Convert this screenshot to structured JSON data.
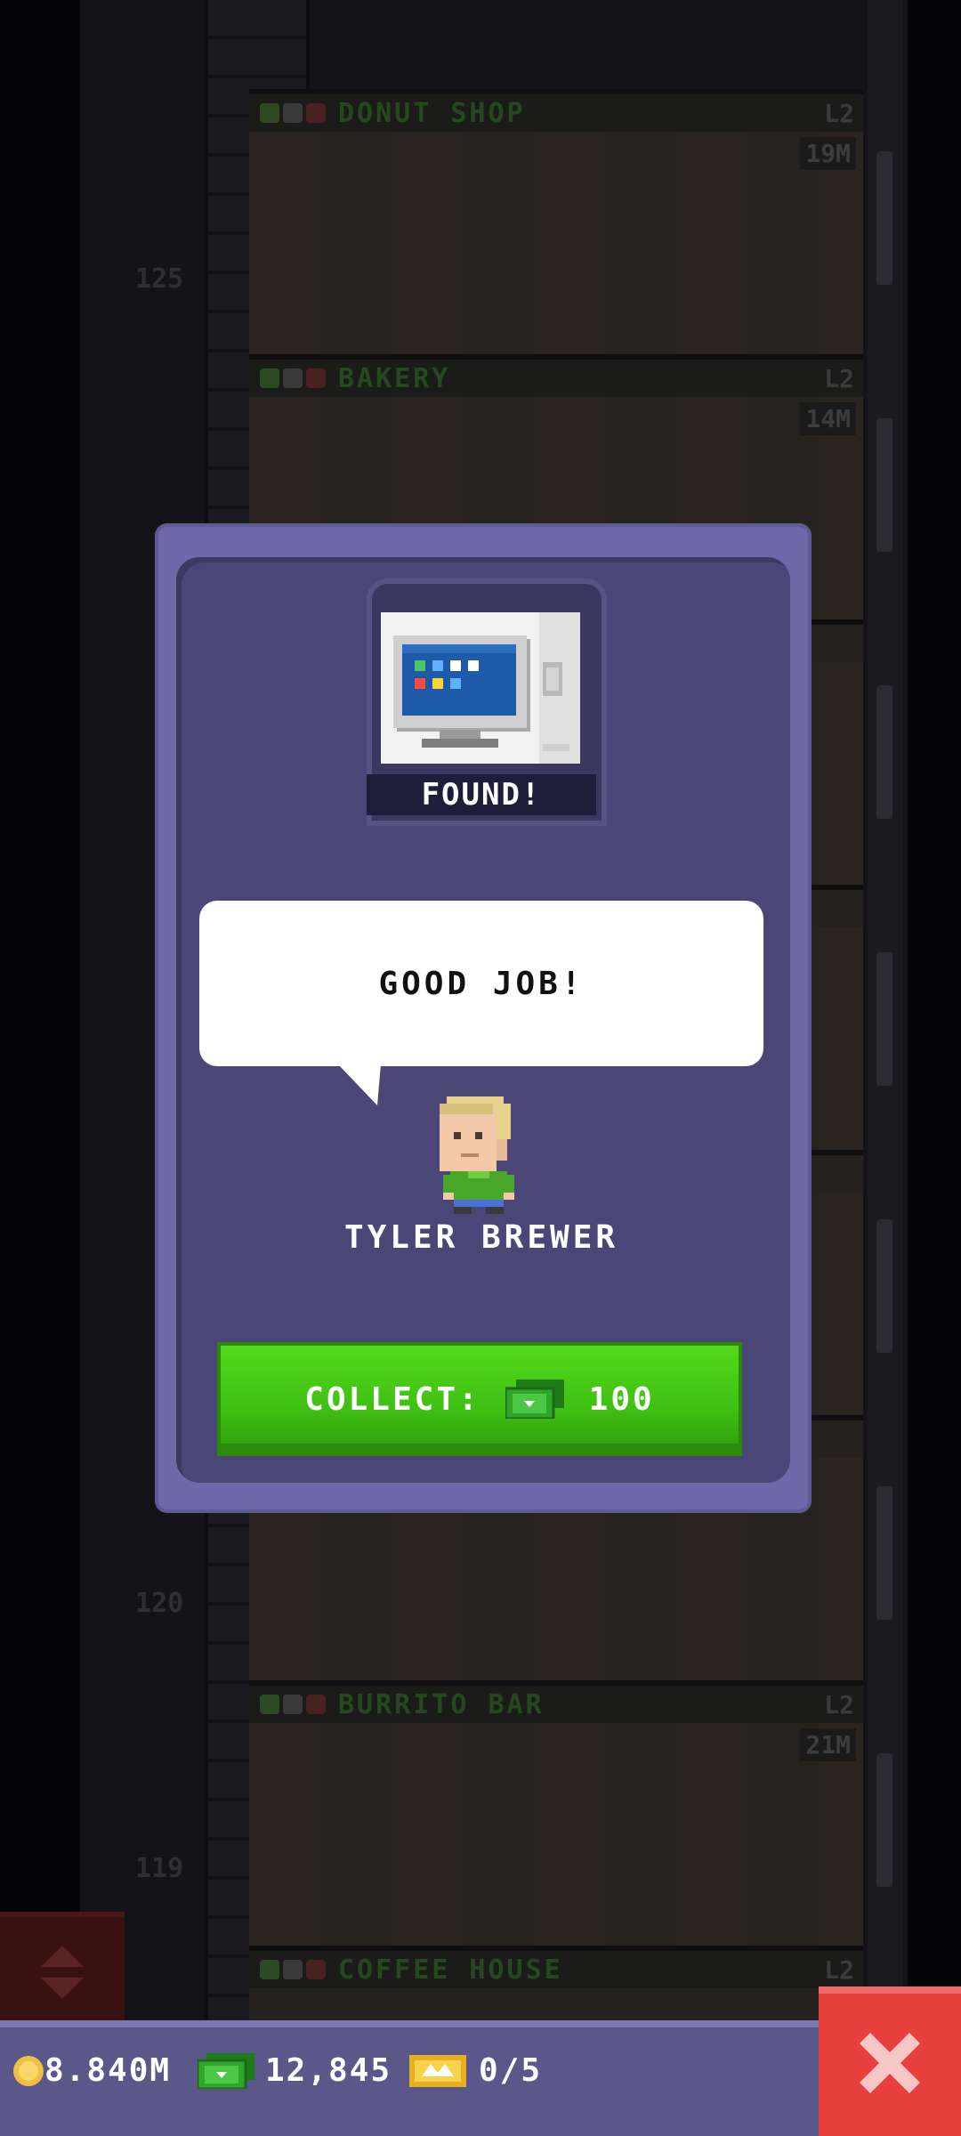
{
  "tower": {
    "floors": [
      {
        "name": "DONUT SHOP",
        "level": "L2",
        "income": "19M",
        "number": "125"
      },
      {
        "name": "BAKERY",
        "level": "L2",
        "income": "14M",
        "number": ""
      },
      {
        "name": "BURRITO BAR",
        "level": "L2",
        "income": "21M",
        "number": "120"
      },
      {
        "name": "COFFEE HOUSE",
        "level": "L2",
        "income": "",
        "number": "119"
      }
    ]
  },
  "dialog": {
    "found_label": "FOUND!",
    "item_icon": "computer-icon",
    "speech": "GOOD JOB!",
    "character_name": "TYLER BREWER",
    "collect_label": "COLLECT:",
    "collect_amount": "100"
  },
  "status_bar": {
    "coins": "8.840M",
    "bux": "12,845",
    "tickets": "0/5"
  },
  "colors": {
    "dialog_bg": "#4a4777",
    "collect_green": "#46c615",
    "close_red": "#e83f3f"
  }
}
